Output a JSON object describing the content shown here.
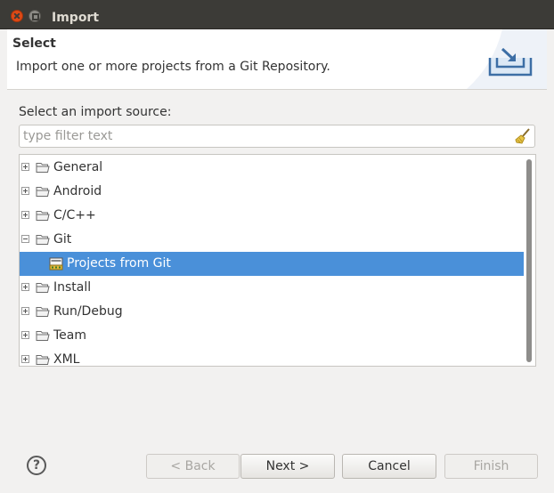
{
  "window": {
    "title": "Import"
  },
  "header": {
    "title": "Select",
    "description": "Import one or more projects from a Git Repository."
  },
  "source_label": "Select an import source:",
  "filter": {
    "placeholder": "type filter text",
    "value": ""
  },
  "tree": {
    "items": [
      {
        "label": "General",
        "expanded": false
      },
      {
        "label": "Android",
        "expanded": false
      },
      {
        "label": "C/C++",
        "expanded": false
      },
      {
        "label": "Git",
        "expanded": true
      },
      {
        "label": "Projects from Git",
        "child": true,
        "selected": true
      },
      {
        "label": "Install",
        "expanded": false
      },
      {
        "label": "Run/Debug",
        "expanded": false
      },
      {
        "label": "Team",
        "expanded": false
      },
      {
        "label": "XML",
        "expanded": false
      }
    ]
  },
  "buttons": {
    "help": "?",
    "back": "< Back",
    "next": "Next >",
    "cancel": "Cancel",
    "finish": "Finish"
  },
  "colors": {
    "selection": "#4a90d9",
    "titlebar": "#3c3b37",
    "close": "#df4a16"
  }
}
